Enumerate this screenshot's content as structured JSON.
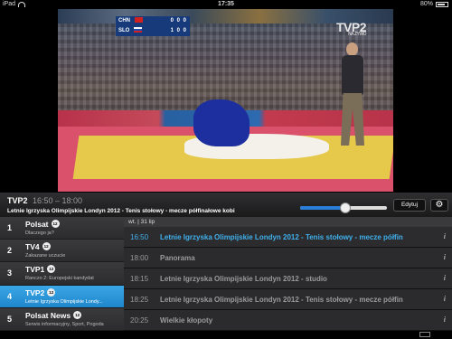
{
  "status_bar": {
    "device": "iPad",
    "time": "17:35",
    "battery": "80%",
    "battery_level": 0.8
  },
  "video": {
    "scoreboard": [
      {
        "country": "CHN",
        "score": "0 0 0"
      },
      {
        "country": "SLO",
        "score": "1 0 0"
      }
    ],
    "watermark": "TVP2",
    "watermark_sub": "NA ŻYWO"
  },
  "now_playing": {
    "channel": "TVP2",
    "time_range": "16:50 – 18:00",
    "title": "Letnie Igrzyska Olimpijskie Londyn 2012 - Tenis stołowy - mecze półfinałowe kobi",
    "progress": 0.52
  },
  "controls": {
    "edit_label": "Edytuj",
    "settings_icon": "gear-icon"
  },
  "channels": [
    {
      "num": "1",
      "name": "Polsat",
      "age": "12",
      "sub": "Dlaczego ja?"
    },
    {
      "num": "2",
      "name": "TV4",
      "age": "12",
      "sub": "Zakazane uczucie"
    },
    {
      "num": "3",
      "name": "TVP1",
      "age": "12",
      "sub": "Ranczo 2: Europejski kandydat"
    },
    {
      "num": "4",
      "name": "TVP2",
      "age": "12",
      "sub": "Letnie Igrzyska Olimpijskie Londy..."
    },
    {
      "num": "5",
      "name": "Polsat News",
      "age": "12",
      "sub": "Serwis informacyjny, Sport, Pogoda"
    }
  ],
  "schedule": {
    "day": "wt. | 31 lip",
    "rows": [
      {
        "time": "16:50",
        "title": "Letnie Igrzyska Olimpijskie Londyn 2012 - Tenis stołowy - mecze półfin",
        "info": "i"
      },
      {
        "time": "18:00",
        "title": "Panorama",
        "info": "i"
      },
      {
        "time": "18:15",
        "title": "Letnie Igrzyska Olimpijskie Londyn 2012 - studio",
        "info": "i"
      },
      {
        "time": "18:25",
        "title": "Letnie Igrzyska Olimpijskie Londyn 2012 - Tenis stołowy - mecze półfin",
        "info": "i"
      },
      {
        "time": "20:25",
        "title": "Wielkie kłopoty",
        "info": "i"
      }
    ]
  },
  "colors": {
    "accent": "#3fb0ec",
    "active_row": "#1f86cc"
  }
}
